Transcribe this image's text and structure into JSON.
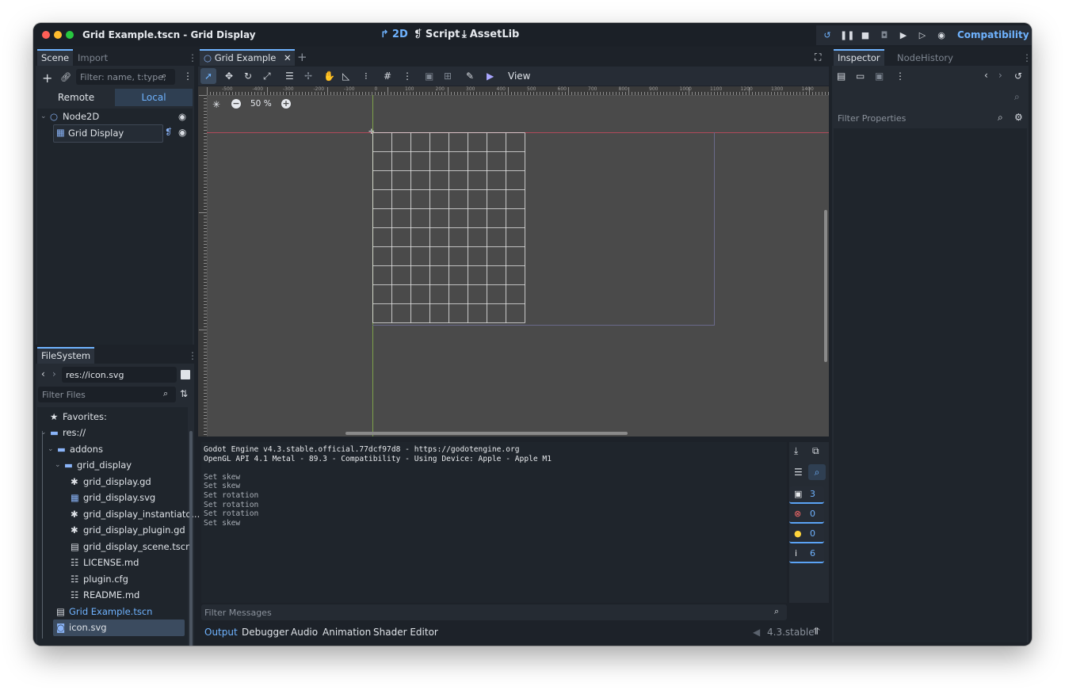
{
  "window": {
    "title": "Grid Example.tscn - Grid Display",
    "workspaces": [
      "2D",
      "Script",
      "AssetLib"
    ],
    "renderer": "Compatibility"
  },
  "scene_dock": {
    "tabs": [
      "Scene",
      "Import"
    ],
    "filter_placeholder": "Filter: name, t:type,",
    "remote_label": "Remote",
    "local_label": "Local",
    "nodes": [
      {
        "label": "Node2D",
        "icon": "node2d-icon"
      },
      {
        "label": "Grid Display",
        "icon": "grid-icon"
      }
    ]
  },
  "filesystem": {
    "tab": "FileSystem",
    "path": "res://icon.svg",
    "filter_placeholder": "Filter Files",
    "items": [
      {
        "label": "Favorites:",
        "icon": "star-icon"
      },
      {
        "label": "res://",
        "icon": "folder-icon"
      },
      {
        "label": "addons",
        "icon": "folder-icon"
      },
      {
        "label": "grid_display",
        "icon": "folder-icon"
      },
      {
        "label": "grid_display.gd",
        "icon": "gear-icon"
      },
      {
        "label": "grid_display.svg",
        "icon": "grid-icon"
      },
      {
        "label": "grid_display_instantiato...",
        "icon": "gear-icon"
      },
      {
        "label": "grid_display_plugin.gd",
        "icon": "gear-icon"
      },
      {
        "label": "grid_display_scene.tscn",
        "icon": "clapper-icon"
      },
      {
        "label": "LICENSE.md",
        "icon": "doc-icon"
      },
      {
        "label": "plugin.cfg",
        "icon": "doc-icon"
      },
      {
        "label": "README.md",
        "icon": "doc-icon"
      },
      {
        "label": "Grid Example.tscn",
        "icon": "clapper-icon"
      },
      {
        "label": "icon.svg",
        "icon": "image-icon"
      }
    ]
  },
  "editor": {
    "scene_tab": "Grid Example",
    "view_menu": "View",
    "zoom": "50 %",
    "ruler_labels": [
      "-500",
      "-400",
      "-300",
      "-200",
      "-100",
      "0",
      "100",
      "200",
      "300",
      "400",
      "500",
      "600",
      "700",
      "800",
      "900",
      "1000",
      "1100",
      "1200",
      "1300",
      "1400",
      "150"
    ],
    "vruler_labels": [
      "0",
      "100",
      "200",
      "300",
      "400",
      "500",
      "600",
      "700",
      "800",
      "900",
      "1000"
    ]
  },
  "output": {
    "lines": [
      "Godot Engine v4.3.stable.official.77dcf97d8 - https://godotengine.org",
      "OpenGL API 4.1 Metal - 89.3 - Compatibility - Using Device: Apple - Apple M1",
      "",
      "Set skew",
      "Set skew",
      "Set rotation",
      "Set rotation",
      "Set rotation",
      "Set skew"
    ],
    "filter_placeholder": "Filter Messages",
    "counts": {
      "messages": "3",
      "errors": "0",
      "warnings": "0",
      "info": "6"
    },
    "bottom_tabs": [
      "Output",
      "Debugger",
      "Audio",
      "Animation",
      "Shader Editor"
    ],
    "version": "4.3.stable"
  },
  "inspector": {
    "tabs": [
      "Inspector",
      "Node",
      "History"
    ],
    "filter_placeholder": "Filter Properties"
  },
  "colors": {
    "accent": "#6fb3ff",
    "panel": "#252b33",
    "viewport": "#4a4a4a",
    "close_red": "#ff5f57",
    "min_yellow": "#febc2e",
    "max_green": "#28c840"
  }
}
